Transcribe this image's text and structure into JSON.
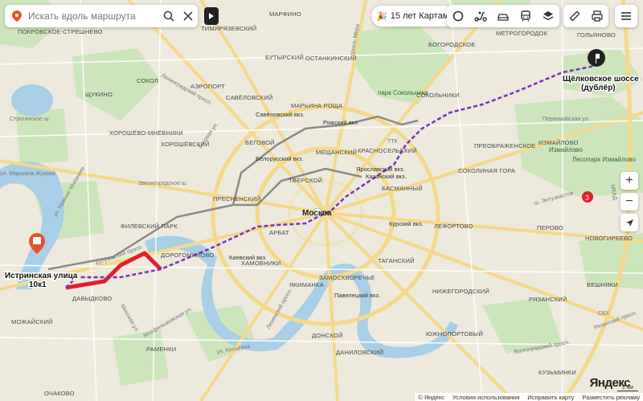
{
  "search": {
    "placeholder": "Искать вдоль маршрута"
  },
  "promo": {
    "label": "15 лет Картам"
  },
  "colors": {
    "route": "#7b2fbe",
    "highlight": "#e41e2b",
    "park": "#c7e2b5",
    "water": "#a9cfe6",
    "ring_road": "#f5d98a",
    "traffic_gray": "#8a8a8a"
  },
  "start_point": {
    "line1": "Истринская улица",
    "line2": "10к1"
  },
  "end_point": {
    "line1": "Щёлковское шоссе",
    "line2": "(дублёр)"
  },
  "city_label": "Москва",
  "districts": [
    "ПОКРОВСКОЕ-СТРЕШНЕВО",
    "ТИМИРЯЗЕВСКИЙ",
    "МАРФИНО",
    "ОСТАНКИНСКИЙ",
    "МЕТРОГОРОДОК",
    "ГОЛЬЯНОВО",
    "ЩУКИНО",
    "СОКОЛ",
    "АЭРОПОРТ",
    "САВЁЛОВСКИЙ",
    "МАРЬИНА РОЩА",
    "БУТЫРСКИЙ",
    "БОГОРОДСКОЕ",
    "ХОРОШЁВО-МНЁВНИКИ",
    "ХОРОШЁВСКИЙ",
    "БЕГОВОЙ",
    "МЕЩАНСКИЙ",
    "КРАСНОСЕЛЬСКИЙ",
    "СОКОЛЬНИКИ",
    "ПРЕОБРАЖЕНСКОЕ",
    "ИЗМАЙЛОВО",
    "ПРЕСНЕНСКИЙ",
    "ТВЕРСКОЙ",
    "БАСМАННЫЙ",
    "СОКОЛИНАЯ ГОРА",
    "ФИЛЁВСКИЙ ПАРК",
    "АРБАТ",
    "ЛЕФОРТОВО",
    "ПЕРОВО",
    "НОВОГИРЕЕВО",
    "ДОРОГОМИЛОВО",
    "ХАМОВНИКИ",
    "ЯКИМАНКА",
    "ЗАМОСКВОРЕЧЬЕ",
    "ТАГАНСКИЙ",
    "НИЖЕГОРОДСКИЙ",
    "ВЕШНЯКИ",
    "ДАВЫДКОВО",
    "РАМЕНКИ",
    "ДОНСКОЙ",
    "ДАНИЛОВСКИЙ",
    "ЮЖНОПОРТОВЫЙ",
    "РЯЗАНСКИЙ",
    "КУЗЬМИНКИ",
    "МОЖАЙСКИЙ",
    "ОЧАКОВО"
  ],
  "stations": [
    "Савёловский вкз.",
    "Рижский вкз.",
    "Белорусский вкз.",
    "Ярославский вкз.",
    "Казанский вкз.",
    "Курский вкз.",
    "Киевский вкз.",
    "Павелецкий вкз."
  ],
  "parks": [
    "парк Сокольники",
    "Измайлово",
    "Лесопарк Измайлово"
  ],
  "roads": [
    "ул. Маршала Жукова",
    "Звенигородское ш.",
    "Ленинградский просп.",
    "Беговая ул.",
    "Кутузовский просп.",
    "Мосфильмовская ул.",
    "Первомайская ул.",
    "ш. Энтузиастов",
    "Рязанский просп.",
    "Волгоградский просп.",
    "ТТК",
    "МКАД",
    "СВХ",
    "ул. Косыгина",
    "Ленинский просп.",
    "просп. Мира",
    "Минская ул.",
    "ул. Нижние Мнёвники",
    "Строгинское ш."
  ],
  "footer": {
    "copyright": "© Яндекс",
    "terms": "Условия использования",
    "fix_map": "Исправить карту",
    "ads": "Разместить рекламу"
  },
  "logo": "Яндекс",
  "scale_label": "2 км",
  "metro_badge": "3"
}
